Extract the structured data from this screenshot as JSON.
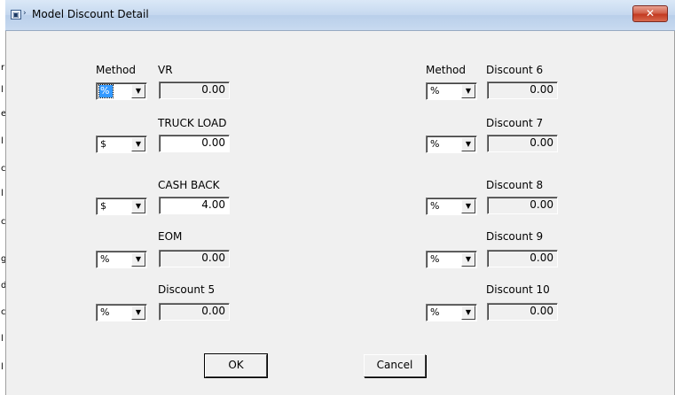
{
  "window": {
    "title": "Model Discount Detail",
    "close_label": "✕"
  },
  "labels": {
    "method_left": "Method",
    "method_right": "Method"
  },
  "left_rows": [
    {
      "name": "VR",
      "method": "%",
      "value": "0.00",
      "editable": false
    },
    {
      "name": "TRUCK LOAD",
      "method": "$",
      "value": "0.00",
      "editable": true
    },
    {
      "name": "CASH BACK",
      "method": "$",
      "value": "4.00",
      "editable": true
    },
    {
      "name": "EOM",
      "method": "%",
      "value": "0.00",
      "editable": false
    },
    {
      "name": "Discount 5",
      "method": "%",
      "value": "0.00",
      "editable": false
    }
  ],
  "right_rows": [
    {
      "name": "Discount 6",
      "method": "%",
      "value": "0.00"
    },
    {
      "name": "Discount 7",
      "method": "%",
      "value": "0.00"
    },
    {
      "name": "Discount 8",
      "method": "%",
      "value": "0.00"
    },
    {
      "name": "Discount 9",
      "method": "%",
      "value": "0.00"
    },
    {
      "name": "Discount 10",
      "method": "%",
      "value": "0.00"
    }
  ],
  "buttons": {
    "ok": "OK",
    "cancel": "Cancel"
  },
  "icons": {
    "window_icon": "window-icon",
    "dropdown": "chevron-down-icon",
    "close": "close-icon"
  }
}
